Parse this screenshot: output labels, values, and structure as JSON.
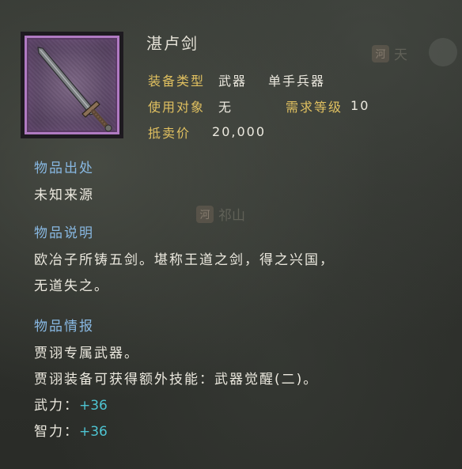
{
  "map": {
    "label_qishan": "祁山",
    "chip_he": "河",
    "label_tian": "天",
    "chip_he2": "河"
  },
  "item": {
    "name": "湛卢剑",
    "equip_type_label": "装备类型",
    "equip_type_value": "武器",
    "equip_subtype_value": "单手兵器",
    "user_label": "使用对象",
    "user_value": "无",
    "req_level_label": "需求等级",
    "req_level_value": "10",
    "sell_price_label": "抵卖价",
    "sell_price_value": "20,000",
    "frame_color": "#b07ac2"
  },
  "sections": {
    "origin": {
      "title": "物品出处",
      "text": "未知来源"
    },
    "description": {
      "title": "物品说明",
      "line1": "欧冶子所铸五剑。堪称王道之剑，得之兴国，",
      "line2": "无道失之。"
    },
    "intel": {
      "title": "物品情报",
      "line1": "贾诩专属武器。",
      "line2": "贾诩装备可获得额外技能：武器觉醒(二)。",
      "stat1_label": "武力：",
      "stat1_value": "+36",
      "stat2_label": "智力：",
      "stat2_value": "+36"
    }
  },
  "colors": {
    "label_gold": "#e0c060",
    "section_blue": "#88b8e2",
    "bonus_cyan": "#4ec4d2",
    "text": "#ece9df"
  }
}
